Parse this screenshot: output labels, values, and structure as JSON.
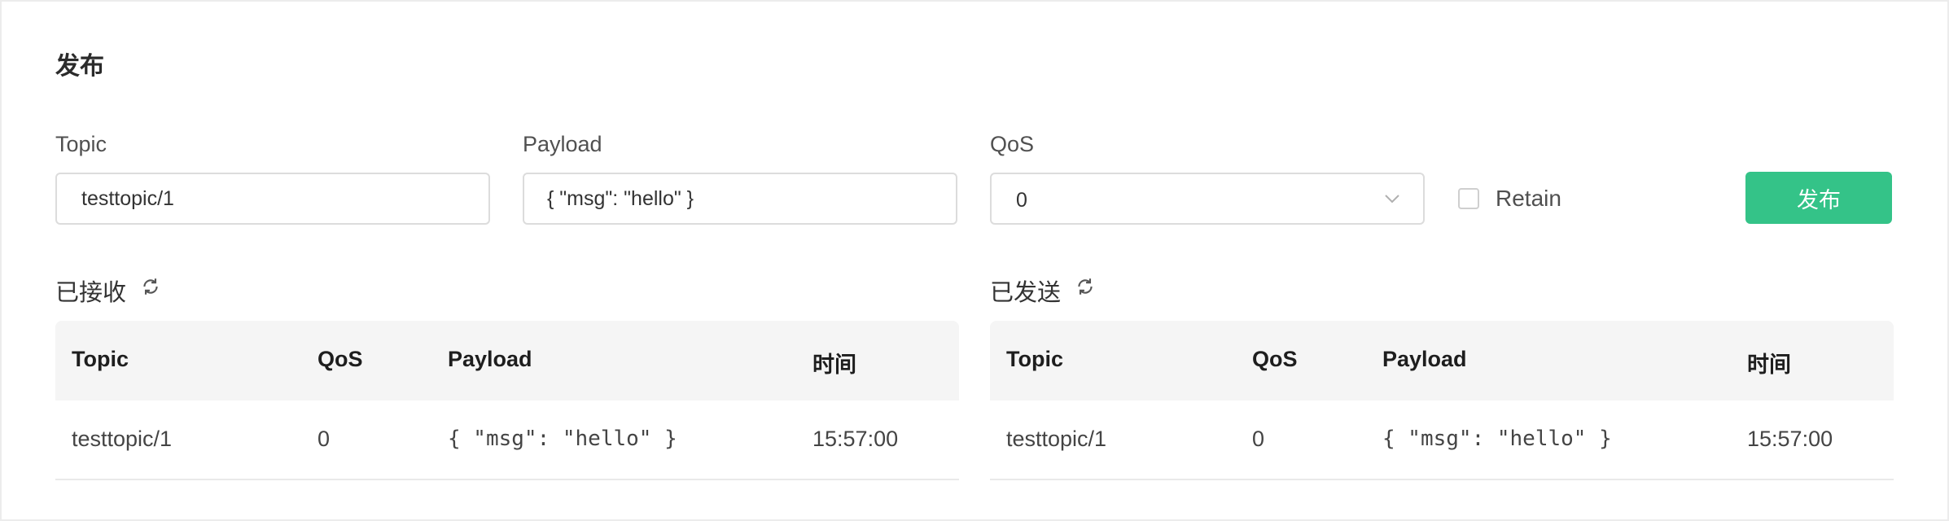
{
  "publish": {
    "title": "发布",
    "topic_label": "Topic",
    "topic_value": "testtopic/1",
    "payload_label": "Payload",
    "payload_value": "{ \"msg\": \"hello\" }",
    "qos_label": "QoS",
    "qos_value": "0",
    "retain_label": "Retain",
    "retain_checked": false,
    "button_label": "发布",
    "button_color": "#34c388"
  },
  "received": {
    "title": "已接收",
    "refresh_icon": "refresh-icon",
    "columns": [
      "Topic",
      "QoS",
      "Payload",
      "时间"
    ],
    "rows": [
      {
        "topic": "testtopic/1",
        "qos": "0",
        "payload": "{ \"msg\": \"hello\" }",
        "time": "15:57:00"
      }
    ]
  },
  "sent": {
    "title": "已发送",
    "refresh_icon": "refresh-icon",
    "columns": [
      "Topic",
      "QoS",
      "Payload",
      "时间"
    ],
    "rows": [
      {
        "topic": "testtopic/1",
        "qos": "0",
        "payload": "{ \"msg\": \"hello\" }",
        "time": "15:57:00"
      }
    ]
  }
}
